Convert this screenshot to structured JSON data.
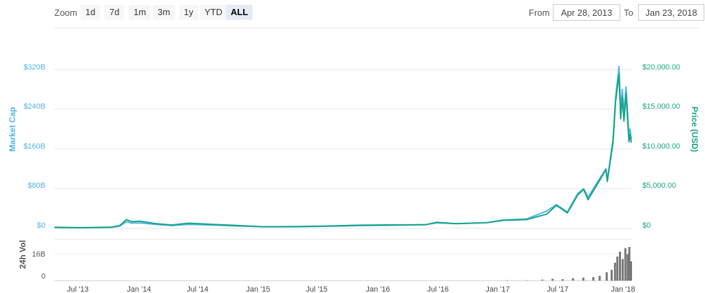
{
  "toolbar": {
    "zoom_label": "Zoom",
    "zoom_buttons": [
      "1d",
      "7d",
      "1m",
      "3m",
      "1y",
      "YTD",
      "ALL"
    ],
    "active_zoom": "ALL",
    "from_label": "From",
    "from_value": "Apr 28, 2013",
    "to_label": "To",
    "to_value": "Jan 23, 2018"
  },
  "colors": {
    "market_cap": "#4fb5e6",
    "price": "#17a487",
    "volume": "#777777",
    "grid": "#e6e6e6"
  },
  "chart_data": [
    {
      "type": "line",
      "x_labels": [
        "Jul '13",
        "Jan '14",
        "Jul '14",
        "Jan '15",
        "Jul '15",
        "Jan '16",
        "Jul '16",
        "Jan '17",
        "Jul '17",
        "Jan '18"
      ],
      "x_range": [
        "2013-04-28",
        "2018-01-23"
      ],
      "yaxis_left": {
        "title": "Market Cap",
        "ticks": [
          "$0",
          "$80B",
          "$160B",
          "$240B",
          "$320B"
        ],
        "range": [
          0,
          320
        ]
      },
      "yaxis_right": {
        "title": "Price (USD)",
        "ticks": [
          "$0",
          "$5,000.00",
          "$10,000.00",
          "$15,000.00",
          "$20,000.00"
        ],
        "range": [
          0,
          20000
        ]
      },
      "grid": true,
      "series": [
        {
          "name": "Market Cap",
          "axis": "left",
          "points": [
            [
              "2013-04-28",
              1.5
            ],
            [
              "2013-07-15",
              1.0
            ],
            [
              "2013-10-15",
              2.0
            ],
            [
              "2013-11-10",
              4.5
            ],
            [
              "2013-11-30",
              13.5
            ],
            [
              "2013-12-15",
              10.5
            ],
            [
              "2014-01-10",
              11.0
            ],
            [
              "2014-02-25",
              8.0
            ],
            [
              "2014-04-15",
              5.5
            ],
            [
              "2014-06-05",
              8.0
            ],
            [
              "2014-08-15",
              6.5
            ],
            [
              "2014-10-15",
              5.0
            ],
            [
              "2015-01-15",
              3.0
            ],
            [
              "2015-04-15",
              3.2
            ],
            [
              "2015-07-15",
              4.0
            ],
            [
              "2015-11-05",
              5.5
            ],
            [
              "2016-01-15",
              6.0
            ],
            [
              "2016-05-15",
              7.5
            ],
            [
              "2016-06-18",
              11.0
            ],
            [
              "2016-08-15",
              9.5
            ],
            [
              "2016-11-15",
              11.5
            ],
            [
              "2017-01-05",
              17.0
            ],
            [
              "2017-03-15",
              19.0
            ],
            [
              "2017-05-15",
              35.0
            ],
            [
              "2017-06-12",
              48.0
            ],
            [
              "2017-07-15",
              33.0
            ],
            [
              "2017-08-15",
              70.0
            ],
            [
              "2017-09-02",
              80.0
            ],
            [
              "2017-09-15",
              63.0
            ],
            [
              "2017-10-15",
              95.0
            ],
            [
              "2017-11-08",
              120.0
            ],
            [
              "2017-11-12",
              97.0
            ],
            [
              "2017-11-29",
              180.0
            ],
            [
              "2017-12-07",
              265.0
            ],
            [
              "2017-12-17",
              326.0
            ],
            [
              "2017-12-22",
              240.0
            ],
            [
              "2017-12-27",
              280.0
            ],
            [
              "2018-01-01",
              230.0
            ],
            [
              "2018-01-07",
              285.0
            ],
            [
              "2018-01-12",
              230.0
            ],
            [
              "2018-01-16",
              185.0
            ],
            [
              "2018-01-19",
              200.0
            ],
            [
              "2018-01-23",
              180.0
            ]
          ]
        },
        {
          "name": "Price (USD)",
          "axis": "right",
          "points": [
            [
              "2013-04-28",
              135
            ],
            [
              "2013-07-15",
              90
            ],
            [
              "2013-10-15",
              150
            ],
            [
              "2013-11-10",
              350
            ],
            [
              "2013-11-30",
              1100
            ],
            [
              "2013-12-15",
              850
            ],
            [
              "2014-01-10",
              900
            ],
            [
              "2014-02-25",
              600
            ],
            [
              "2014-04-15",
              420
            ],
            [
              "2014-06-05",
              650
            ],
            [
              "2014-08-15",
              500
            ],
            [
              "2014-10-15",
              390
            ],
            [
              "2015-01-15",
              210
            ],
            [
              "2015-04-15",
              225
            ],
            [
              "2015-07-15",
              285
            ],
            [
              "2015-11-05",
              400
            ],
            [
              "2016-01-15",
              430
            ],
            [
              "2016-05-15",
              450
            ],
            [
              "2016-06-18",
              760
            ],
            [
              "2016-08-15",
              580
            ],
            [
              "2016-11-15",
              710
            ],
            [
              "2017-01-05",
              1000
            ],
            [
              "2017-03-15",
              1100
            ],
            [
              "2017-05-15",
              1800
            ],
            [
              "2017-06-12",
              2900
            ],
            [
              "2017-07-15",
              1950
            ],
            [
              "2017-08-15",
              4200
            ],
            [
              "2017-09-02",
              4900
            ],
            [
              "2017-09-15",
              3600
            ],
            [
              "2017-10-15",
              5700
            ],
            [
              "2017-11-08",
              7400
            ],
            [
              "2017-11-12",
              5900
            ],
            [
              "2017-11-29",
              10800
            ],
            [
              "2017-12-07",
              16000
            ],
            [
              "2017-12-17",
              19400
            ],
            [
              "2017-12-22",
              13800
            ],
            [
              "2017-12-27",
              16500
            ],
            [
              "2018-01-01",
              13500
            ],
            [
              "2018-01-07",
              17000
            ],
            [
              "2018-01-12",
              13400
            ],
            [
              "2018-01-16",
              10900
            ],
            [
              "2018-01-19",
              11800
            ],
            [
              "2018-01-23",
              10800
            ]
          ]
        }
      ]
    },
    {
      "type": "bar",
      "title": "24h Vol",
      "yticks": [
        "0",
        "16B"
      ],
      "range": [
        0,
        32
      ],
      "unit": "B USD",
      "points": [
        [
          "2017-01-15",
          0.2
        ],
        [
          "2017-03-15",
          0.3
        ],
        [
          "2017-05-01",
          0.8
        ],
        [
          "2017-06-01",
          1.5
        ],
        [
          "2017-07-01",
          1.2
        ],
        [
          "2017-08-01",
          2.0
        ],
        [
          "2017-09-01",
          2.5
        ],
        [
          "2017-10-01",
          3.0
        ],
        [
          "2017-10-20",
          4.0
        ],
        [
          "2017-11-10",
          7.0
        ],
        [
          "2017-11-25",
          9.0
        ],
        [
          "2017-12-05",
          15.0
        ],
        [
          "2017-12-12",
          20.0
        ],
        [
          "2017-12-20",
          24.0
        ],
        [
          "2017-12-28",
          18.0
        ],
        [
          "2018-01-05",
          27.0
        ],
        [
          "2018-01-12",
          22.0
        ],
        [
          "2018-01-17",
          28.0
        ],
        [
          "2018-01-22",
          16.0
        ]
      ]
    }
  ]
}
